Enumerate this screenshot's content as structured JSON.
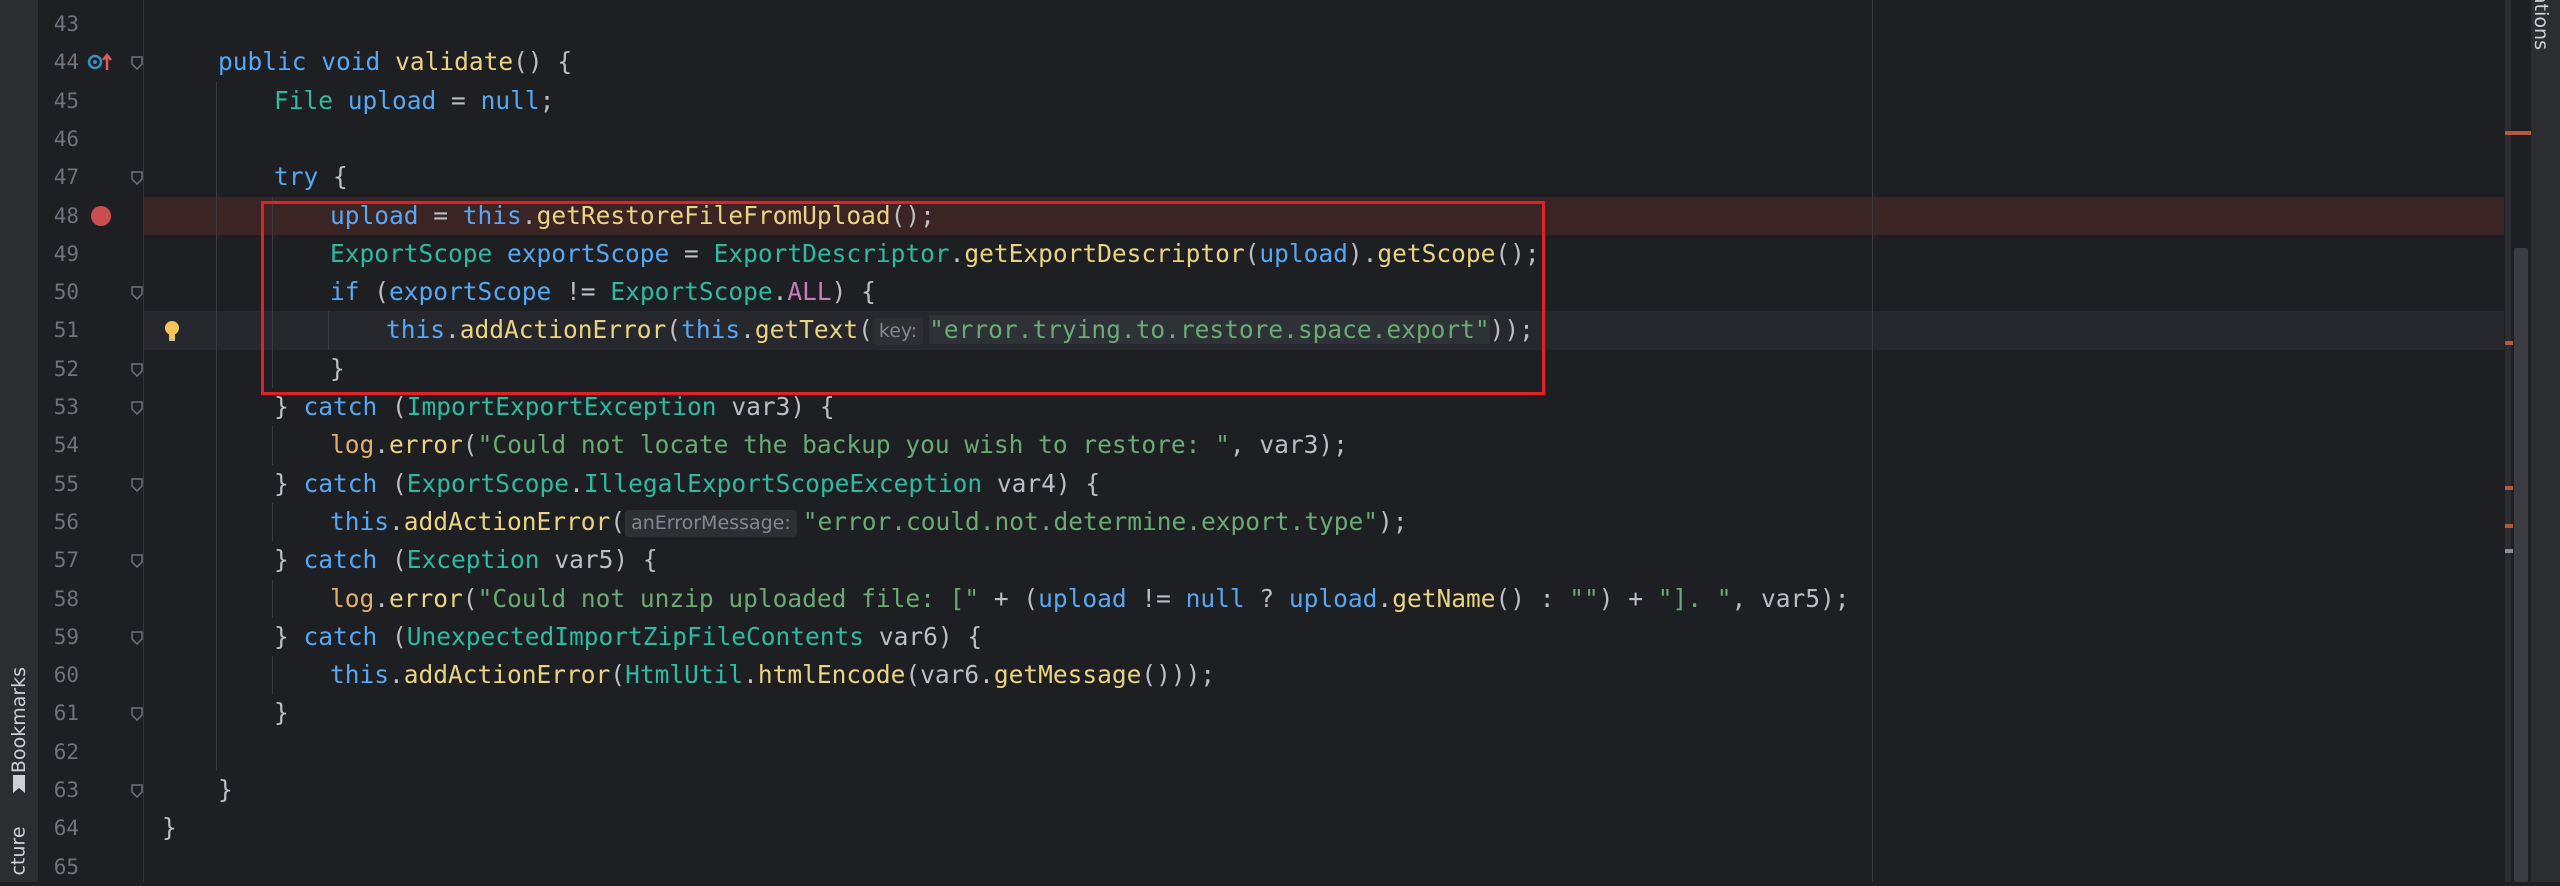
{
  "sidebar": {
    "bookmarks_label": "Bookmarks",
    "structure_label": "cture"
  },
  "right_panel": {
    "notifications_label": "ations"
  },
  "editor": {
    "line_numbers": [
      "43",
      "44",
      "45",
      "46",
      "47",
      "48",
      "49",
      "50",
      "51",
      "52",
      "53",
      "54",
      "55",
      "56",
      "57",
      "58",
      "59",
      "60",
      "61",
      "62",
      "63",
      "64",
      "65"
    ],
    "lines": [
      "",
      "public void validate() {",
      "File upload = null;",
      "",
      "try {",
      "upload = this.getRestoreFileFromUpload();",
      "ExportScope exportScope = ExportDescriptor.getExportDescriptor(upload).getScope();",
      "if (exportScope != ExportScope.ALL) {",
      "this.addActionError(this.getText(\"error.trying.to.restore.space.export\"));",
      "}",
      "} catch (ImportExportException var3) {",
      "log.error(\"Could not locate the backup you wish to restore: \", var3);",
      "} catch (ExportScope.IllegalExportScopeException var4) {",
      "this.addActionError(\"error.could.not.determine.export.type\");",
      "} catch (Exception var5) {",
      "log.error(\"Could not unzip uploaded file: [\" + (upload != null ? upload.getName() : \"\") + \"]. \", var5);",
      "} catch (UnexpectedImportZipFileContents var6) {",
      "this.addActionError(HtmlUtil.htmlEncode(var6.getMessage()));",
      "}",
      "",
      "}",
      "}",
      ""
    ],
    "param_hints": {
      "key": "key:",
      "an_error_message": "anErrorMessage:"
    },
    "breakpoint_line": "48",
    "current_line": "51",
    "colors": {
      "background": "#1e1f22",
      "keyword": "#56a8f5",
      "type": "#2fbaa3",
      "string": "#6aab73",
      "method": "#ebd481",
      "highlight_box": "#e02127",
      "breakpoint": "#c94f4f"
    },
    "icons": {
      "line_44": "override-method-icon",
      "line_48": "breakpoint-icon",
      "line_51": "lightbulb-icon"
    }
  }
}
